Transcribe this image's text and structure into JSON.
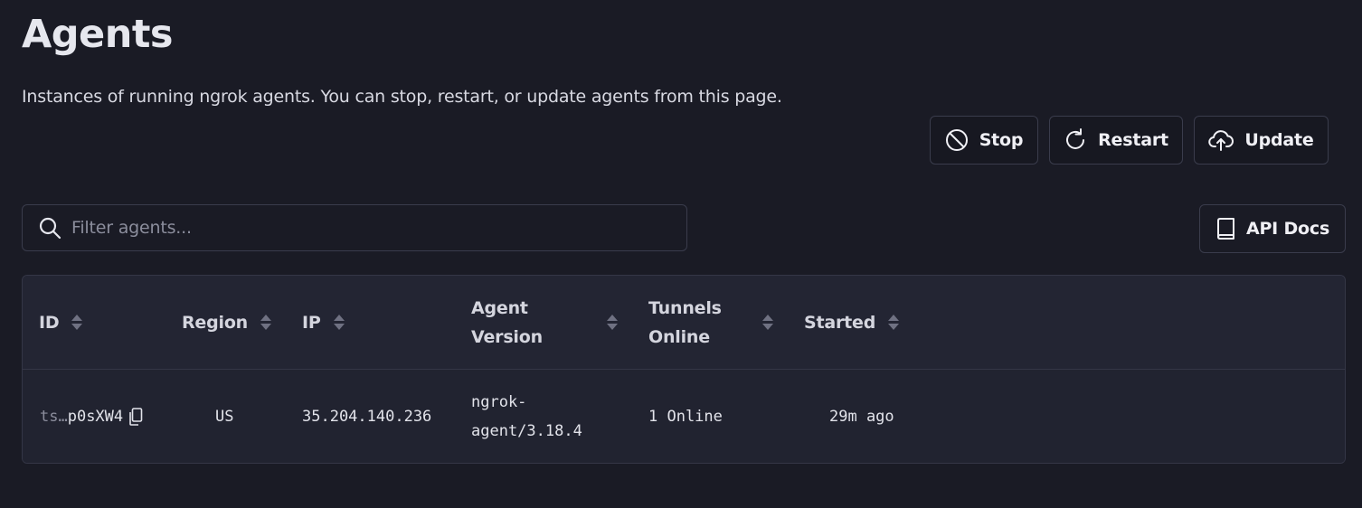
{
  "page": {
    "title": "Agents",
    "description": "Instances of running ngrok agents. You can stop, restart, or update agents from this page."
  },
  "search": {
    "placeholder": "Filter agents..."
  },
  "api_docs": {
    "label": "API Docs",
    "icon": "book-icon"
  },
  "table": {
    "columns": {
      "id": "ID",
      "region": "Region",
      "ip": "IP",
      "agent_version": "Agent Version",
      "tunnels_online": "Tunnels Online",
      "started": "Started"
    },
    "rows": [
      {
        "id_prefix": "ts…",
        "id_suffix": "p0sXW4",
        "region": "US",
        "ip": "35.204.140.236",
        "agent_version_line1": "ngrok-",
        "agent_version_line2": "agent/3.18.4",
        "tunnels_online": "1 Online",
        "started": "29m ago",
        "actions": {
          "stop": "Stop",
          "restart": "Restart",
          "update": "Update"
        }
      }
    ]
  },
  "colors": {
    "background": "#1a1b25",
    "table_bg": "#212330",
    "border": "#3a3c4c"
  }
}
